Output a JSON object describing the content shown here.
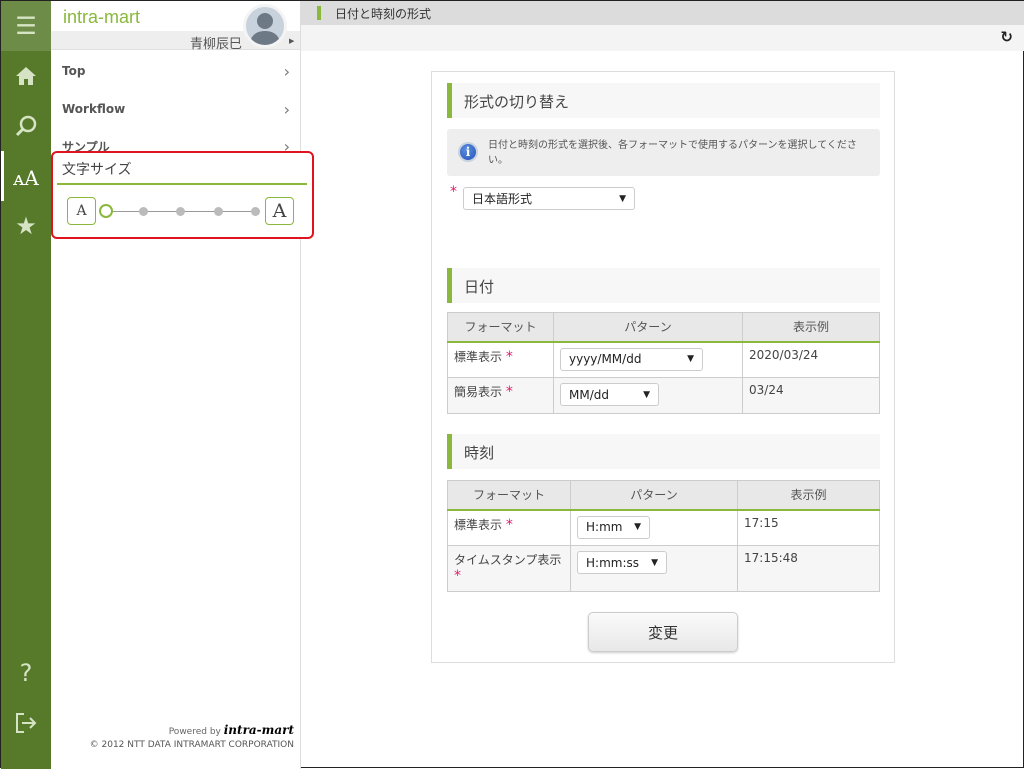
{
  "colors": {
    "accent": "#8ab83d",
    "rail": "#567a2a",
    "required": "#e5186b",
    "highlight": "#e0141e"
  },
  "sidebar": {
    "logo": "intra-mart",
    "user_name": "青柳辰巳",
    "menu": [
      {
        "label": "Top"
      },
      {
        "label": "Workflow"
      },
      {
        "label": "サンプル"
      }
    ],
    "font_size": {
      "title": "文字サイズ",
      "small_label": "A",
      "large_label": "A",
      "steps": 5,
      "current_step": 1
    },
    "footer": {
      "powered_by": "Powered by",
      "brand": "intra-mart",
      "copyright": "© 2012 NTT DATA INTRAMART CORPORATION"
    },
    "rail_icons": [
      "menu-icon",
      "home-icon",
      "search-icon",
      "font-size-icon",
      "star-icon",
      "help-icon",
      "logout-icon"
    ]
  },
  "header": {
    "title": "日付と時刻の形式"
  },
  "main": {
    "switch_section": {
      "title": "形式の切り替え",
      "info": "日付と時刻の形式を選択後、各フォーマットで使用するパターンを選択してください。",
      "required": "*",
      "format_value": "日本語形式"
    },
    "date_section": {
      "title": "日付",
      "headers": [
        "フォーマット",
        "パターン",
        "表示例"
      ],
      "rows": [
        {
          "format": "標準表示",
          "pattern": "yyyy/MM/dd",
          "example": "2020/03/24"
        },
        {
          "format": "簡易表示",
          "pattern": "MM/dd",
          "example": "03/24"
        }
      ]
    },
    "time_section": {
      "title": "時刻",
      "headers": [
        "フォーマット",
        "パターン",
        "表示例"
      ],
      "rows": [
        {
          "format": "標準表示",
          "pattern": "H:mm",
          "example": "17:15"
        },
        {
          "format": "タイムスタンプ表示",
          "pattern": "H:mm:ss",
          "example": "17:15:48"
        }
      ]
    },
    "submit_label": "変更"
  }
}
